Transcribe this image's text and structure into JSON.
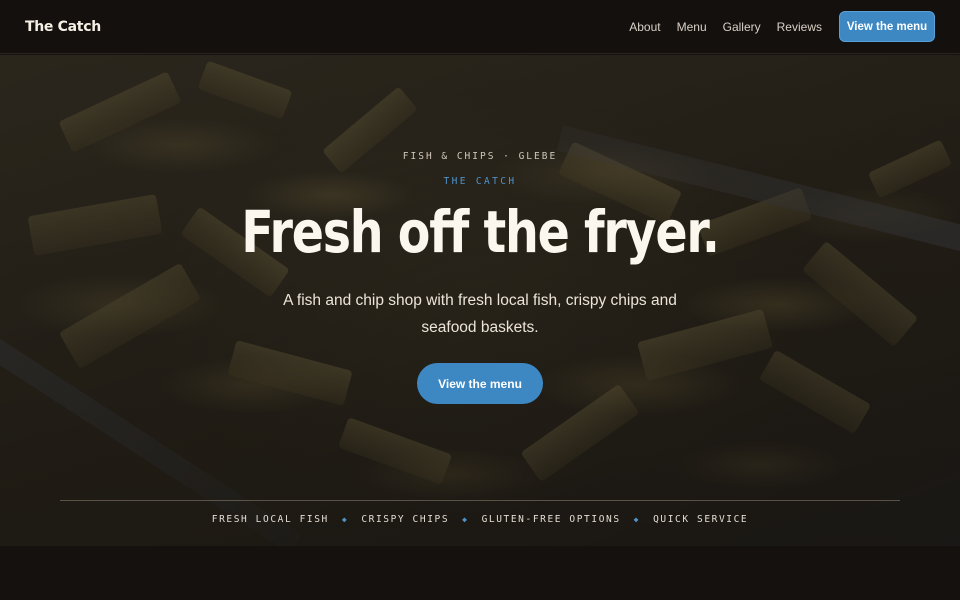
{
  "header": {
    "brand": "The Catch",
    "nav": [
      "About",
      "Menu",
      "Gallery",
      "Reviews"
    ],
    "cta_label": "View the menu"
  },
  "hero": {
    "eyebrow": "FISH & CHIPS · GLEBE",
    "kicker": "THE CATCH",
    "headline": "Fresh off the fryer.",
    "tagline": "A fish and chip shop with fresh local fish, crispy chips and seafood baskets.",
    "cta_label": "View the menu",
    "features": [
      "FRESH LOCAL FISH",
      "CRISPY CHIPS",
      "GLUTEN-FREE OPTIONS",
      "QUICK SERVICE"
    ],
    "feature_separator": "◆"
  },
  "colors": {
    "accent": "#3d87c2",
    "kicker": "#4f93c9",
    "background": "#14110f",
    "text": "#f3ece2"
  }
}
